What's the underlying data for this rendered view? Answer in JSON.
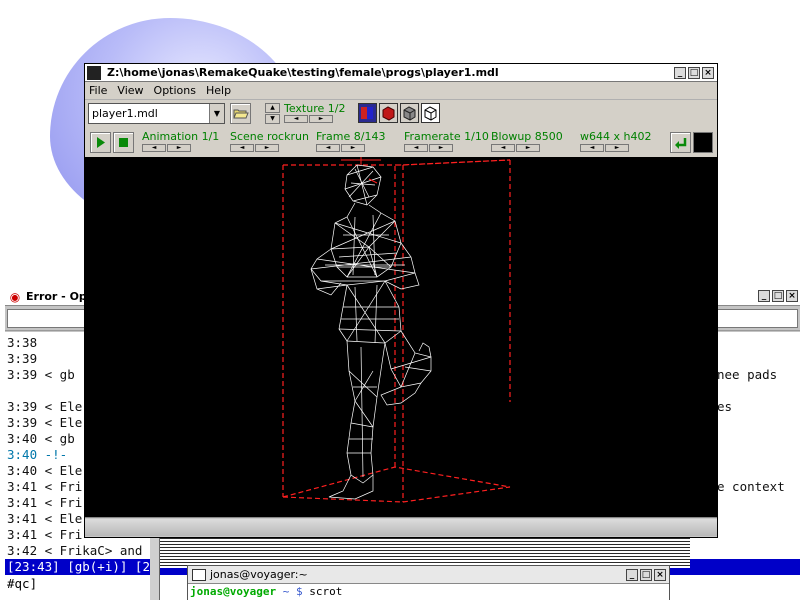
{
  "desktop": {
    "accent_blob": "#9a9df0"
  },
  "irc": {
    "title": "Error - Op",
    "lines": [
      {
        "text": "3:38"
      },
      {
        "text": "3:39"
      },
      {
        "text": "3:39 < gb"
      },
      {
        "text": ""
      },
      {
        "text": "3:39 < Ele"
      },
      {
        "text": "3:39 < Ele"
      },
      {
        "text": "3:40 < gb"
      },
      {
        "text": "3:40 -!- "
      },
      {
        "text": "3:40 < Ele"
      },
      {
        "text": "3:41 < Fri"
      },
      {
        "text": "3:41 < Fri"
      },
      {
        "text": "3:41 < Ele"
      },
      {
        "text": "3:41 < Fri"
      },
      {
        "text": "3:42 < FrikaC> and"
      }
    ],
    "right_fragments": [
      "nee pads",
      "es",
      "e context"
    ],
    "status": "[23:43] [gb(+i)] [2",
    "input_prompt": "#qc]"
  },
  "terminal": {
    "title": "jonas@voyager:~",
    "prompt_user": "jonas@voyager",
    "prompt_path": " ~ $ ",
    "command": "scrot"
  },
  "viewer": {
    "title": "Z:\\home\\jonas\\RemakeQuake\\testing\\female\\progs\\player1.mdl",
    "menu": [
      "File",
      "View",
      "Options",
      "Help"
    ],
    "model_select": "player1.mdl",
    "texture_label": "Texture 1/2",
    "controls": [
      {
        "key": "animation",
        "label": "Animation 1/1"
      },
      {
        "key": "scene",
        "label": "Scene rockrun"
      },
      {
        "key": "frame",
        "label": "Frame 8/143"
      },
      {
        "key": "framerate",
        "label": "Framerate 1/10"
      },
      {
        "key": "blowup",
        "label": "Blowup 8500"
      },
      {
        "key": "size",
        "label": "w644 x h402"
      }
    ],
    "label_color": "#008000",
    "bbox_color": "#ff2020",
    "wire_color": "#ffffff"
  }
}
